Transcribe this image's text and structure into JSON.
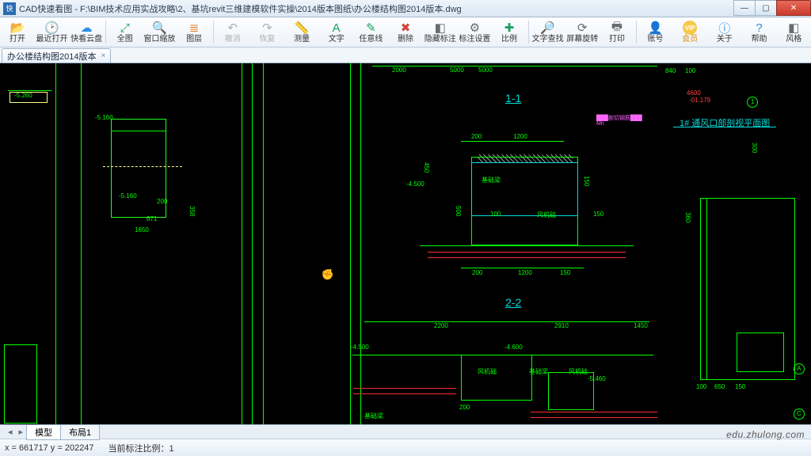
{
  "window": {
    "app_icon": "快",
    "title": "CAD快速看图 - F:\\BIM技术应用实战攻略\\2、基坑revit三维建模软件实操\\2014版本图纸\\办公楼结构图2014版本.dwg",
    "min": "—",
    "max": "▢",
    "close": "✕"
  },
  "toolbar": [
    {
      "id": "open",
      "icon": "📂",
      "label": "打开",
      "c": "#2b8fe6"
    },
    {
      "id": "recent",
      "icon": "🕑",
      "label": "最近打开",
      "c": "#2b8fe6"
    },
    {
      "id": "cloud",
      "icon": "☁",
      "label": "快看云盘",
      "c": "#2b8fe6"
    },
    {
      "sep": true
    },
    {
      "id": "full",
      "icon": "⤢",
      "label": "全图",
      "c": "#1aa260"
    },
    {
      "id": "winzoom",
      "icon": "🔍",
      "label": "窗口缩放",
      "c": "#1aa260"
    },
    {
      "id": "layer",
      "icon": "≣",
      "label": "图层",
      "c": "#e07b1e"
    },
    {
      "sep": true
    },
    {
      "id": "undo",
      "icon": "↶",
      "label": "撤消",
      "disabled": true
    },
    {
      "id": "redo",
      "icon": "↷",
      "label": "恢复",
      "disabled": true
    },
    {
      "id": "measure",
      "icon": "📏",
      "label": "测量",
      "c": "#1aa260"
    },
    {
      "id": "text",
      "icon": "A",
      "label": "文字",
      "c": "#1aa260"
    },
    {
      "id": "freeline",
      "icon": "✎",
      "label": "任意线",
      "c": "#1aa260"
    },
    {
      "id": "delete",
      "icon": "✖",
      "label": "删除",
      "c": "#d0443a"
    },
    {
      "id": "hideanno",
      "icon": "◧",
      "label": "隐藏标注",
      "c": "#6a6a6a"
    },
    {
      "id": "annoset",
      "icon": "⚙",
      "label": "标注设置",
      "c": "#6a6a6a"
    },
    {
      "id": "scale",
      "icon": "✚",
      "label": "比例",
      "c": "#1aa260"
    },
    {
      "sep": true
    },
    {
      "id": "findtext",
      "icon": "🔎",
      "label": "文字查找",
      "c": "#2b8fe6"
    },
    {
      "id": "rotate",
      "icon": "⟳",
      "label": "屏幕旋转",
      "c": "#6a6a6a"
    },
    {
      "id": "print",
      "icon": "🖶",
      "label": "打印",
      "c": "#6a6a6a"
    },
    {
      "sep": true
    },
    {
      "id": "account",
      "icon": "👤",
      "label": "账号",
      "c": "#6a6a6a"
    },
    {
      "id": "vip",
      "icon": "VIP",
      "label": "会员",
      "vip": true
    },
    {
      "id": "about",
      "icon": "ⓘ",
      "label": "关于",
      "c": "#2b8fe6"
    },
    {
      "id": "help",
      "icon": "?",
      "label": "帮助",
      "c": "#2b8fe6"
    },
    {
      "id": "style",
      "icon": "◧",
      "label": "风格",
      "c": "#6a6a6a"
    }
  ],
  "doc_tab": {
    "label": "办公楼结构图2014版本",
    "close": "×"
  },
  "drawing": {
    "section1": "1-1",
    "section2": "2-2",
    "title_r": "1# 通风口部剖视平面图",
    "axis_A": "A",
    "axis_C": "C",
    "axis_1": "1",
    "d200": "200",
    "d1200": "1200",
    "d1650": "1650",
    "d5160": "-5.160",
    "d5260": "-5.260",
    "d5460": "-5.460",
    "d4500": "-4.500",
    "d4600": "-4.600",
    "d2200": "2200",
    "d2910": "2910",
    "d1450": "1450",
    "d5000": "5000",
    "d671": "671",
    "d358": "358",
    "d150": "150",
    "d2000": "2000",
    "d500": "500",
    "d450": "450",
    "d840": "840",
    "d100": "100",
    "d650": "650",
    "d300": "300",
    "d360": "360",
    "d200b": "200",
    "grab": "✊",
    "txt_fs1": "风机础",
    "txt_fs2": "风机础",
    "txt_fs3": "风机础",
    "txt_jc": "基础梁",
    "txt_jc2": "基础梁",
    "txt_hatch1": "███剖切钢筋███",
    "txt_mn": "Mn"
  },
  "bottom_tabs": {
    "model": "模型",
    "layout": "布局1",
    "l": "◂",
    "r": "▸"
  },
  "status": {
    "coords": "x = 661717   y = 202247",
    "scale": "当前标注比例：1"
  },
  "watermark": "edu.zhulong.com"
}
